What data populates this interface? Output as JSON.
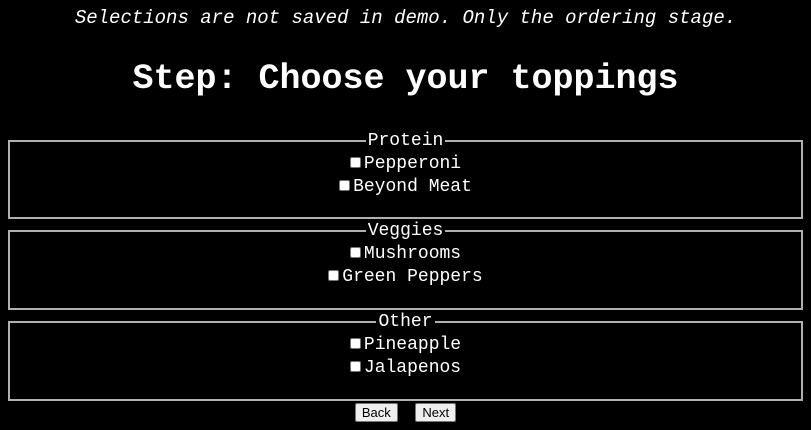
{
  "notice": "Selections are not saved in demo. Only the ordering stage.",
  "title": "Step: Choose your toppings",
  "groups": [
    {
      "legend": "Protein",
      "options": [
        {
          "label": "Pepperoni",
          "checked": false
        },
        {
          "label": "Beyond Meat",
          "checked": false
        }
      ]
    },
    {
      "legend": "Veggies",
      "options": [
        {
          "label": "Mushrooms",
          "checked": false
        },
        {
          "label": "Green Peppers",
          "checked": false
        }
      ]
    },
    {
      "legend": "Other",
      "options": [
        {
          "label": "Pineapple",
          "checked": false
        },
        {
          "label": "Jalapenos",
          "checked": false
        }
      ]
    }
  ],
  "buttons": {
    "back_label": "Back",
    "next_label": "Next"
  },
  "colors": {
    "background": "#000000",
    "text": "#ffffff",
    "border": "#b0b0b0"
  }
}
